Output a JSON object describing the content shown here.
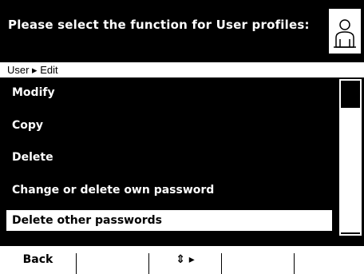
{
  "header": {
    "title": "Please select the function for User profiles:",
    "icon": "user-profile-icon"
  },
  "breadcrumb": "User ▸ Edit",
  "menu": {
    "items": [
      {
        "label": "Modify",
        "selected": false
      },
      {
        "label": "Copy",
        "selected": false
      },
      {
        "label": "Delete",
        "selected": false
      },
      {
        "label": "Change or delete own password",
        "selected": false
      },
      {
        "label": "Delete other passwords",
        "selected": true
      }
    ]
  },
  "softkeys": {
    "key1": "Back",
    "key2": "",
    "key3": "⇕ ▸",
    "key4": "",
    "key5": ""
  },
  "colors": {
    "background": "#000000",
    "foreground": "#ffffff"
  }
}
